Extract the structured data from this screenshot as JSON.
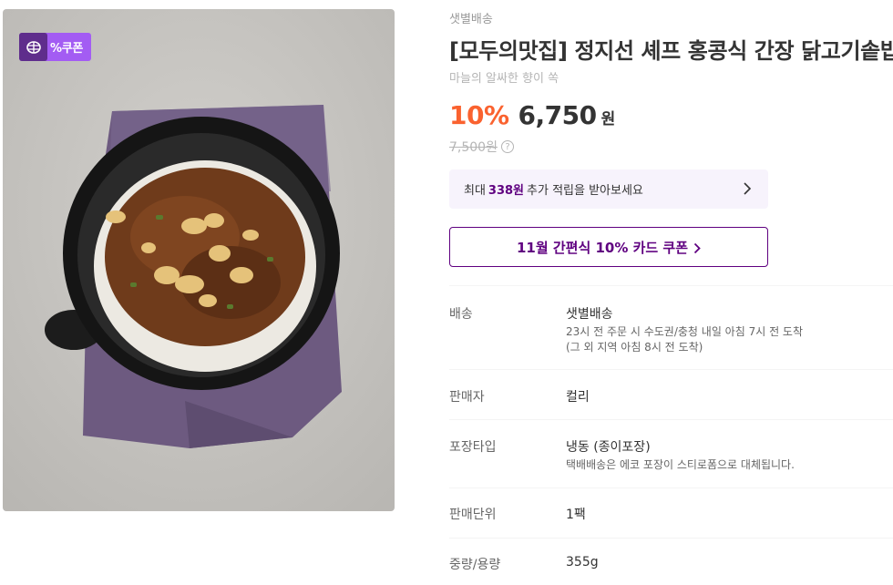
{
  "image": {
    "badge_text": "%쿠폰",
    "colors": {
      "badge": "#a35cf3",
      "badge_logo": "#5f2d8c"
    }
  },
  "product": {
    "delivery_tag": "샛별배송",
    "title": "[모두의맛집] 정지선 셰프 홍콩식 간장 닭고기솥밥",
    "subtitle": "마늘의 알싸한 향이 쏙",
    "discount": "10%",
    "price": "6,750",
    "currency": "원",
    "original_price": "7,500원",
    "help_icon": "?"
  },
  "points": {
    "prefix": "최대",
    "amount": "338원",
    "suffix": "추가 적립을 받아보세요"
  },
  "card_coupon": {
    "label": "11월 간편식 10% 카드 쿠폰"
  },
  "specs": [
    {
      "label": "배송",
      "value": "샛별배송",
      "details": [
        "23시 전 주문 시 수도권/충청 내일 아침 7시 전 도착",
        "(그 외 지역 아침 8시 전 도착)"
      ]
    },
    {
      "label": "판매자",
      "value": "컬리"
    },
    {
      "label": "포장타입",
      "value": "냉동 (종이포장)",
      "details": [
        "택배배송은 에코 포장이 스티로폼으로 대체됩니다."
      ]
    },
    {
      "label": "판매단위",
      "value": "1팩"
    },
    {
      "label": "중량/용량",
      "value": "355g"
    }
  ],
  "colors": {
    "accent": "#5f0080",
    "discount": "#fa622f",
    "point_bg": "#f7f3fc"
  }
}
